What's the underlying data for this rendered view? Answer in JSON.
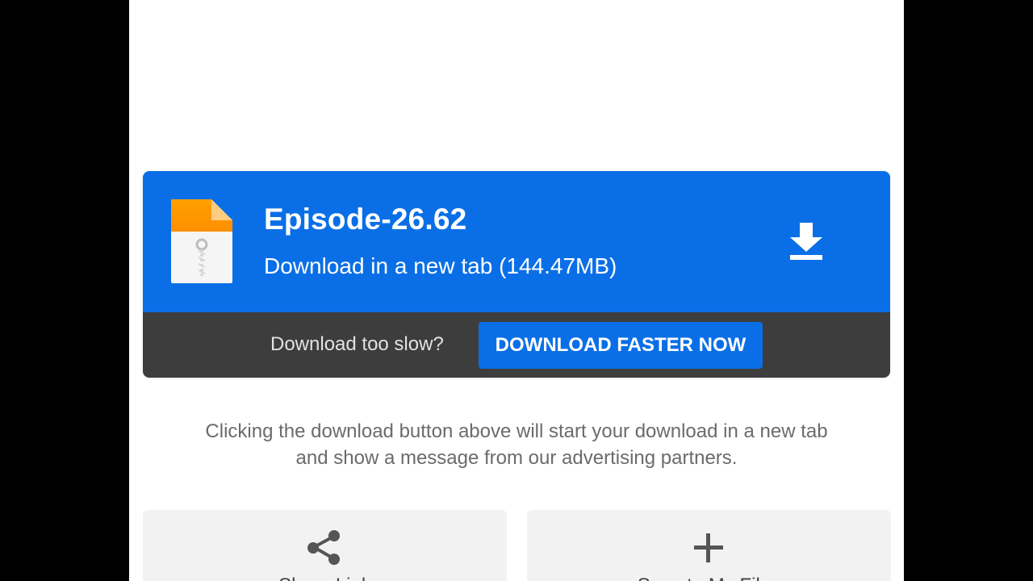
{
  "file": {
    "name": "Episode-26.62",
    "subtitle": "Download in a new tab (144.47MB)",
    "icon": "zip-file-icon",
    "accent_color": "#0a6fe6"
  },
  "speed_bar": {
    "question": "Download too slow?",
    "button_label": "DOWNLOAD FASTER NOW"
  },
  "notice": {
    "line1": "Clicking the download button above will start your download in a new tab",
    "line2": "and show a message from our advertising partners."
  },
  "tiles": [
    {
      "icon": "share-icon",
      "label": "Share Link"
    },
    {
      "icon": "plus-icon",
      "label": "Save to My Files"
    }
  ]
}
